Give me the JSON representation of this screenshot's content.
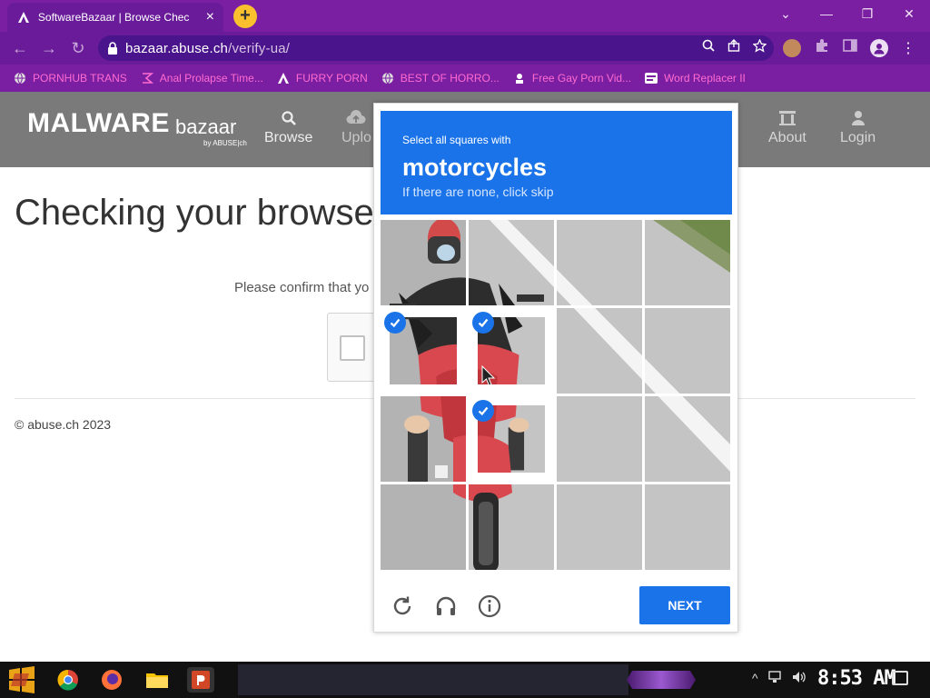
{
  "browser": {
    "tab_title": "SoftwareBazaar | Browse Chec",
    "tab_close": "×",
    "newtab_label": "+",
    "window_controls": {
      "minimize": "—",
      "restore": "❐",
      "close": "✕"
    },
    "nav": {
      "back": "←",
      "forward": "→",
      "reload": "↻"
    },
    "url_host": "bazaar.abuse.ch",
    "url_path": "/verify-ua/",
    "bookmarks": [
      {
        "label": "PORNHUB TRANS",
        "icon": "globe-icon"
      },
      {
        "label": "Anal Prolapse Time...",
        "icon": "bracket-icon"
      },
      {
        "label": "FURRY PORN",
        "icon": "lambda-icon"
      },
      {
        "label": "BEST OF HORRO...",
        "icon": "globe-icon"
      },
      {
        "label": "Free Gay Porn Vid...",
        "icon": "site-icon"
      },
      {
        "label": "Word Replacer II",
        "icon": "wr-icon"
      }
    ]
  },
  "site": {
    "logo_main": "MALWARE",
    "logo_sub": "bazaar",
    "logo_by": "by ABUSE|ch",
    "nav": [
      {
        "label": "Browse",
        "icon": "search-icon"
      },
      {
        "label": "Uplo",
        "icon": "upload-icon"
      },
      {
        "label": "About",
        "icon": "building-icon"
      },
      {
        "label": "Login",
        "icon": "user-icon"
      }
    ],
    "title": "Checking your browser",
    "confirm_text": "Please confirm that yo",
    "copyright": "© abuse.ch 2023"
  },
  "captcha": {
    "prompt_line1": "Select all squares with",
    "prompt_target": "motorcycles",
    "prompt_line3": "If there are none, click skip",
    "next_label": "NEXT",
    "selected_cells": [
      4,
      5,
      9
    ]
  },
  "taskbar": {
    "clock": "8:53 AM"
  },
  "colors": {
    "browser_purple": "#7b1fa2",
    "captcha_blue": "#1a73e8",
    "header_gray": "#7a7a7a"
  }
}
